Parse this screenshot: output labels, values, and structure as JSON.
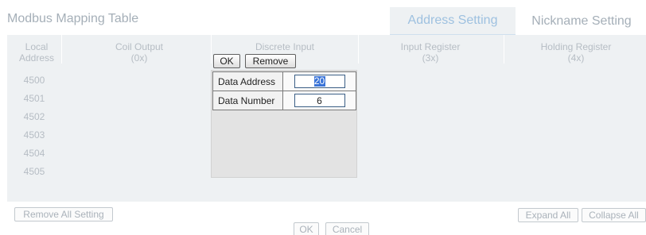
{
  "header": {
    "title": "Modbus Mapping Table",
    "tabs": [
      {
        "label": "Address Setting",
        "active": true
      },
      {
        "label": "Nickname Setting",
        "active": false
      }
    ]
  },
  "table": {
    "columns": [
      {
        "line1": "Local",
        "line2": "Address"
      },
      {
        "line1": "Coil Output",
        "line2": "(0x)"
      },
      {
        "line1": "Discrete Input",
        "line2": ""
      },
      {
        "line1": "Input Register",
        "line2": "(3x)"
      },
      {
        "line1": "Holding Register",
        "line2": "(4x)"
      }
    ],
    "addresses": [
      "4500",
      "4501",
      "4502",
      "4503",
      "4504",
      "4505"
    ]
  },
  "discrete_input_editor": {
    "ok_label": "OK",
    "remove_label": "Remove",
    "fields": [
      {
        "label": "Data Address",
        "value": "20"
      },
      {
        "label": "Data Number",
        "value": "6"
      }
    ]
  },
  "actions": {
    "remove_all_label": "Remove All Setting",
    "expand_all_label": "Expand All",
    "collapse_all_label": "Collapse All"
  },
  "footer": {
    "ok_label": "OK",
    "cancel_label": "Cancel"
  },
  "colors": {
    "panel_bg": "#eef1f3",
    "active_tab_text": "#9ec1e0",
    "selection": "#3a74d8"
  }
}
